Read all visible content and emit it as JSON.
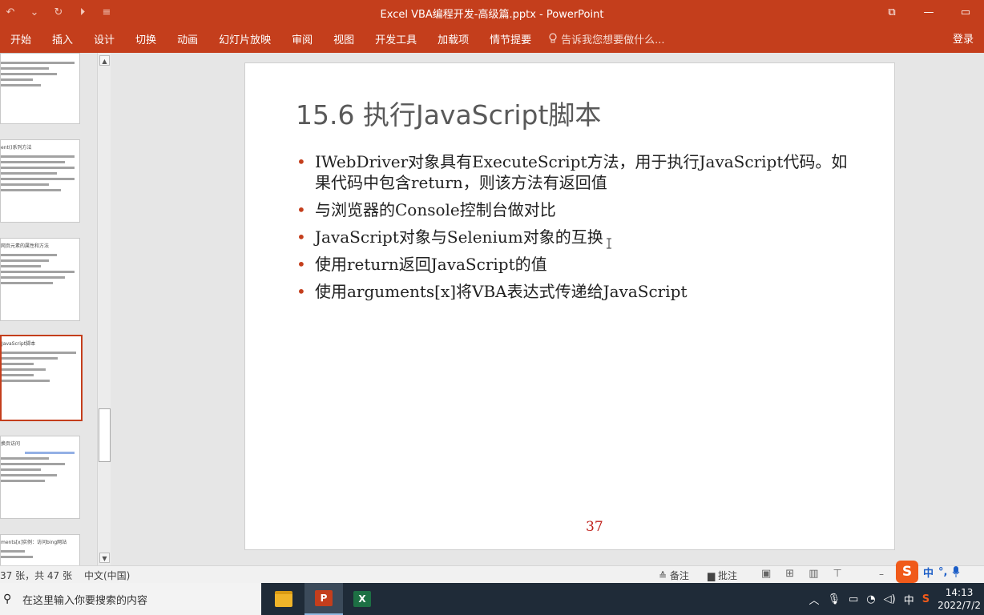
{
  "window": {
    "title": "Excel VBA编程开发-高级篇.pptx - PowerPoint",
    "quick_access": [
      "↶",
      "⌄",
      "↻",
      "⏵",
      "≡"
    ],
    "buttons": [
      "⧉",
      "—",
      "▭"
    ]
  },
  "ribbon": {
    "tabs": [
      "开始",
      "插入",
      "设计",
      "切换",
      "动画",
      "幻灯片放映",
      "审阅",
      "视图",
      "开发工具",
      "加载项",
      "情节提要"
    ],
    "tell_me": "告诉我您想要做什么...",
    "login": "登录"
  },
  "thumbnails": [
    {
      "title": "",
      "selected": false
    },
    {
      "title": "ent()系列方法",
      "selected": false
    },
    {
      "title": "网页元素的属性和方法",
      "selected": false
    },
    {
      "title": "JavaScript脚本",
      "selected": true
    },
    {
      "title": "换页访问",
      "selected": false
    },
    {
      "title": "ments[x]实例：访问bing网站",
      "selected": false
    }
  ],
  "slide": {
    "title": "15.6 执行JavaScript脚本",
    "bullets": [
      "IWebDriver对象具有ExecuteScript方法，用于执行JavaScript代码。如果代码中包含return，则该方法有返回值",
      "与浏览器的Console控制台做对比",
      "JavaScript对象与Selenium对象的互换",
      "使用return返回JavaScript的值",
      "使用arguments[x]将VBA表达式传递给JavaScript"
    ],
    "page_number": "37"
  },
  "status": {
    "slide_info": "37 张，共 47 张",
    "language": "中文(中国)",
    "notes": "备注",
    "comments": "批注",
    "zoom": "–"
  },
  "ime": {
    "label": "中",
    "extra": "°,"
  },
  "taskbar": {
    "search_placeholder": "在这里输入你要搜索的内容",
    "apps": [
      {
        "name": "file-explorer",
        "glyph": "",
        "color": "#f0b429",
        "active": false
      },
      {
        "name": "powerpoint",
        "glyph": "P",
        "color": "#c43e1c",
        "active": true
      },
      {
        "name": "excel",
        "glyph": "X",
        "color": "#1d7044",
        "active": false
      }
    ],
    "tray_ime": "中",
    "time": "14:13",
    "date": "2022/7/2"
  },
  "colors": {
    "accent": "#c43e1c",
    "bullet": "#c43e1c",
    "page_number": "#c0221c"
  }
}
